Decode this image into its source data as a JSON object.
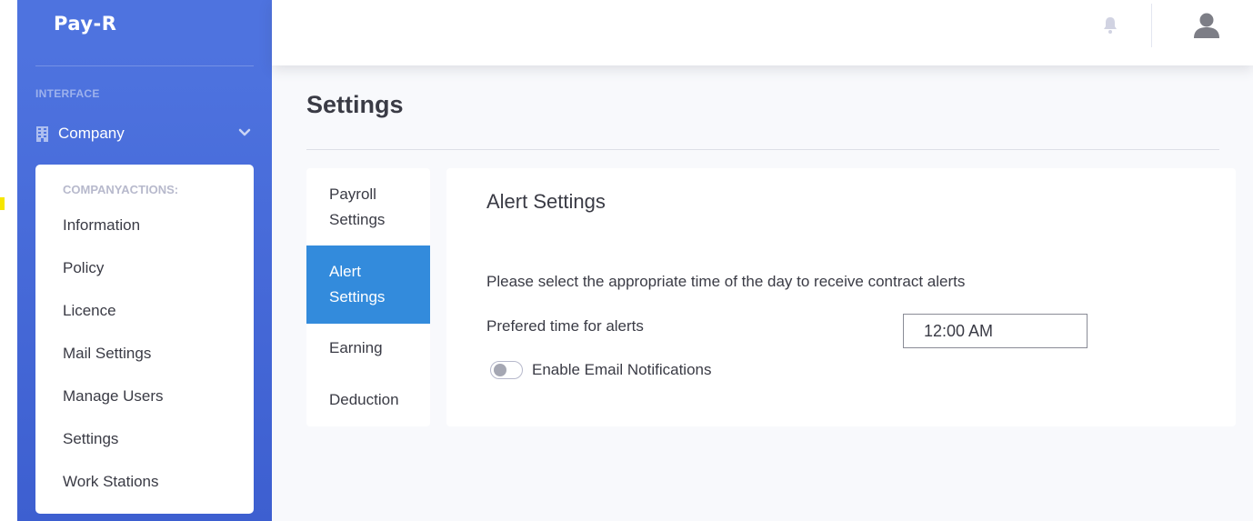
{
  "brand": "Pay-R",
  "sidebar": {
    "heading": "INTERFACE",
    "company_label": "Company",
    "collapse": {
      "heading": "COMPANYACTIONS:",
      "items": [
        {
          "label": "Information"
        },
        {
          "label": "Policy"
        },
        {
          "label": "Licence"
        },
        {
          "label": "Mail Settings"
        },
        {
          "label": "Manage Users"
        },
        {
          "label": "Settings"
        },
        {
          "label": "Work Stations"
        }
      ]
    }
  },
  "topbar": {
    "icons": [
      "bell-icon",
      "user-icon"
    ]
  },
  "page": {
    "title": "Settings"
  },
  "tabs": [
    {
      "label": "Payroll Settings",
      "line1": "Payroll",
      "line2": "Settings",
      "active": false
    },
    {
      "label": "Alert Settings",
      "line1": "Alert",
      "line2": "Settings",
      "active": true
    },
    {
      "label": "Earning",
      "active": false
    },
    {
      "label": "Deduction",
      "active": false
    }
  ],
  "alert_settings": {
    "title": "Alert Settings",
    "description": "Please select the appropriate time of the day to receive contract alerts",
    "time_label": "Prefered time for alerts",
    "time_value": "12:00 AM",
    "email_toggle_label": "Enable Email Notifications",
    "email_enabled": false
  },
  "colors": {
    "sidebar": "#4e73df",
    "active_tab": "#338bdc",
    "background": "#f8f9fc"
  }
}
